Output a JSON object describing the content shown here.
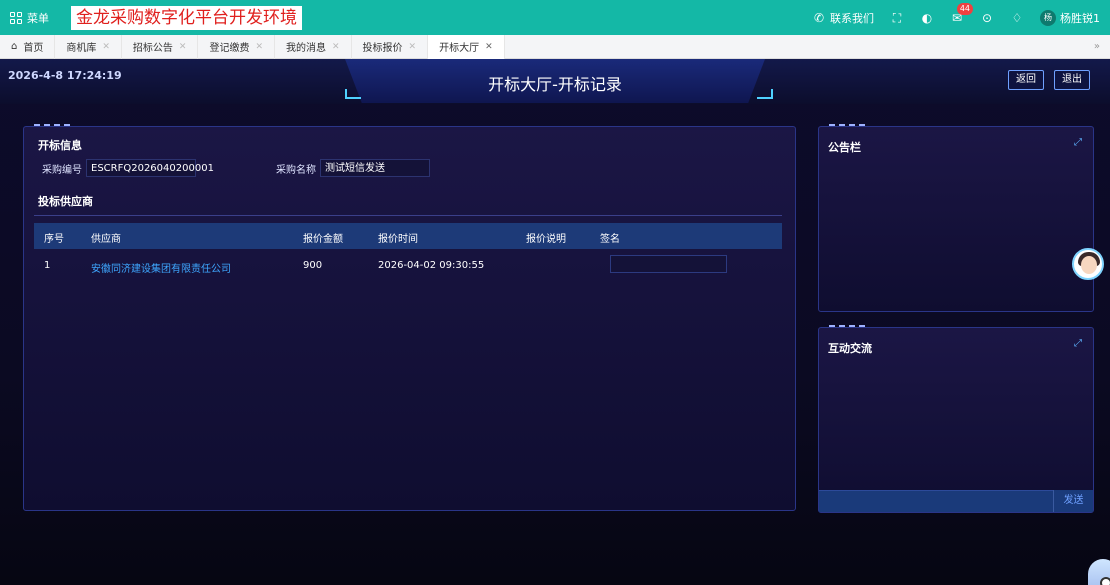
{
  "topbar": {
    "menu_label": "菜单",
    "app_title": "金龙采购数字化平台开发环境",
    "contact_label": "联系我们",
    "mail_badge": "44",
    "user_name": "杨胜锐1",
    "user_avatar_text": "杨"
  },
  "tabs": [
    {
      "label": "首页"
    },
    {
      "label": "商机库"
    },
    {
      "label": "招标公告"
    },
    {
      "label": "登记缴费"
    },
    {
      "label": "我的消息"
    },
    {
      "label": "投标报价"
    },
    {
      "label": "开标大厅"
    }
  ],
  "header": {
    "datetime": "2026-4-8 17:24:19",
    "title": "开标大厅-开标记录",
    "back_label": "返回",
    "exit_label": "退出"
  },
  "bid_info": {
    "section_title": "开标信息",
    "purchase_no_label": "采购编号",
    "purchase_no": "ESCRFQ2026040200001",
    "purchase_name_label": "采购名称",
    "purchase_name": "测试短信发送"
  },
  "suppliers": {
    "section_title": "投标供应商",
    "columns": [
      "序号",
      "供应商",
      "报价金额",
      "报价时间",
      "报价说明",
      "签名"
    ],
    "rows": [
      {
        "index": "1",
        "supplier": "安徽同济建设集团有限责任公司",
        "amount": "900",
        "time": "2026-04-02 09:30:55",
        "note": "",
        "signature": ""
      }
    ]
  },
  "notice_panel": {
    "title": "公告栏"
  },
  "chat_panel": {
    "title": "互动交流",
    "send_label": "发送"
  }
}
